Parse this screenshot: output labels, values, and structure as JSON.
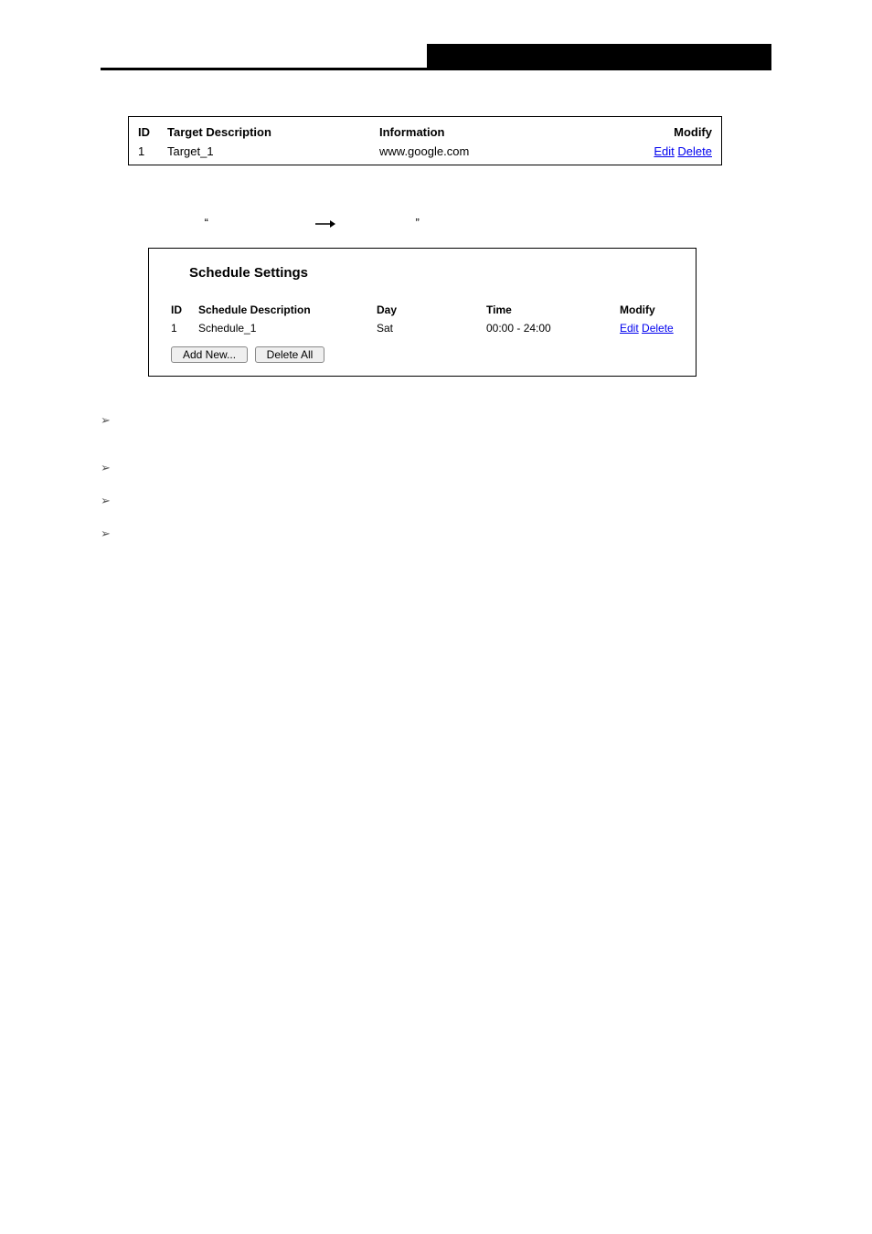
{
  "table1": {
    "headers": {
      "id": "ID",
      "target": "Target Description",
      "info": "Information",
      "modify": "Modify"
    },
    "rows": [
      {
        "id": "1",
        "target": "Target_1",
        "info": "www.google.com",
        "edit": "Edit",
        "delete": "Delete"
      }
    ]
  },
  "nav": {
    "quote_open": "“",
    "quote_close": "”"
  },
  "panel": {
    "title": "Schedule Settings",
    "headers": {
      "id": "ID",
      "desc": "Schedule Description",
      "day": "Day",
      "time": "Time",
      "modify": "Modify"
    },
    "rows": [
      {
        "id": "1",
        "desc": "Schedule_1",
        "day": "Sat",
        "time": "00:00 - 24:00",
        "edit": "Edit",
        "delete": "Delete"
      }
    ],
    "buttons": {
      "add": "Add New...",
      "del": "Delete All"
    }
  },
  "bullets": [
    "",
    "",
    "",
    ""
  ]
}
